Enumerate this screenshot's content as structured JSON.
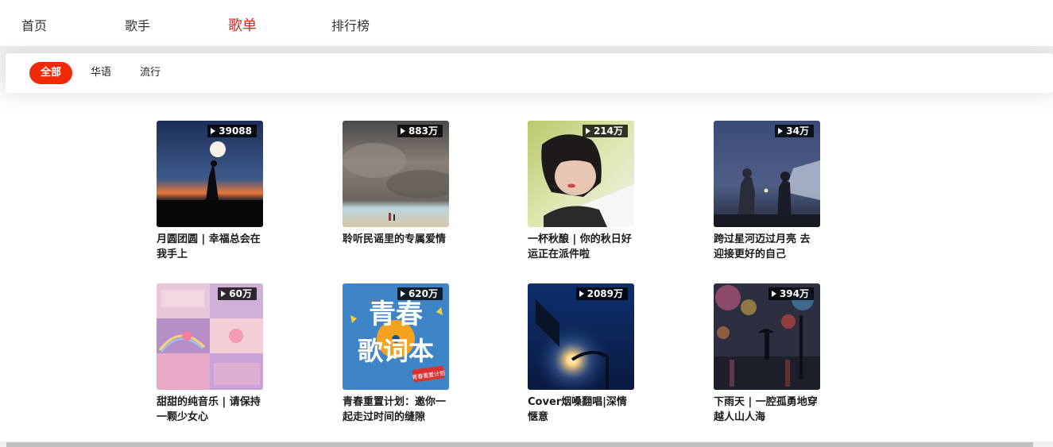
{
  "nav": {
    "items": [
      {
        "label": "首页"
      },
      {
        "label": "歌手"
      },
      {
        "label": "歌单"
      },
      {
        "label": "排行榜"
      }
    ],
    "active_color": "#e02424"
  },
  "filters": {
    "items": [
      {
        "label": "全部"
      },
      {
        "label": "华语"
      },
      {
        "label": "流行"
      }
    ],
    "active_color": "#ee2a08"
  },
  "playlists": [
    {
      "count": "39088",
      "title": "月圆团圆 | 幸福总会在我手上"
    },
    {
      "count": "883万",
      "title": "聆听民谣里的专属爱情"
    },
    {
      "count": "214万",
      "title": "一杯秋酿 | 你的秋日好运正在派件啦"
    },
    {
      "count": "34万",
      "title": "跨过星河迈过月亮 去迎接更好的自己"
    },
    {
      "count": "60万",
      "title": "甜甜的纯音乐 | 请保持一颗少女心"
    },
    {
      "count": "620万",
      "title": "青春重置计划：邀你一起走过时间的缝隙"
    },
    {
      "count": "2089万",
      "title": "Cover烟嗓翻唱|深情惬意"
    },
    {
      "count": "394万",
      "title": "下雨天 | 一腔孤勇地穿越人山人海"
    }
  ],
  "covers": {
    "c6_text_line1": "青春",
    "c6_text_line2": "歌词本",
    "c6_stamp": "青春重置计划"
  }
}
